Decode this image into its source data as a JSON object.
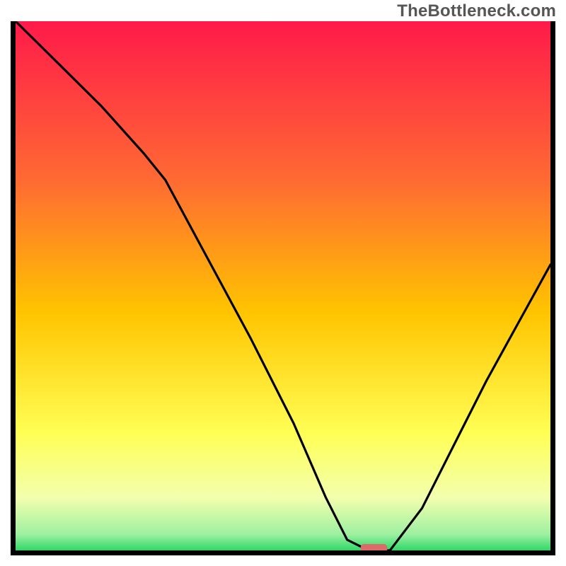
{
  "watermark": "TheBottleneck.com",
  "colors": {
    "gradient_top": "#ff1a4a",
    "gradient_mid1": "#ff7a33",
    "gradient_mid2": "#ffd400",
    "gradient_mid3": "#ffff66",
    "gradient_bottom": "#33e06b",
    "curve": "#000000",
    "marker": "#db6b6b",
    "frame": "#000000"
  },
  "chart_data": {
    "type": "line",
    "title": "",
    "xlabel": "",
    "ylabel": "",
    "xlim": [
      0,
      100
    ],
    "ylim": [
      0,
      100
    ],
    "grid": false,
    "legend": false,
    "series": [
      {
        "name": "bottleneck-curve",
        "x": [
          0,
          8,
          16,
          24,
          28,
          36,
          44,
          52,
          58,
          62,
          66,
          70,
          76,
          82,
          88,
          94,
          100
        ],
        "y": [
          100,
          92,
          84,
          75,
          70,
          55,
          40,
          24,
          10,
          2,
          0,
          0,
          8,
          20,
          32,
          43,
          54
        ]
      }
    ],
    "marker": {
      "x": 67,
      "y": 0,
      "width": 5,
      "height": 1.6
    },
    "background_gradient_stops": [
      {
        "offset": 0.0,
        "color": "#ff1a4a"
      },
      {
        "offset": 0.3,
        "color": "#ff6a33"
      },
      {
        "offset": 0.55,
        "color": "#ffc400"
      },
      {
        "offset": 0.78,
        "color": "#ffff55"
      },
      {
        "offset": 0.9,
        "color": "#f3ffae"
      },
      {
        "offset": 0.97,
        "color": "#9cf0a0"
      },
      {
        "offset": 1.0,
        "color": "#2fd866"
      }
    ]
  }
}
